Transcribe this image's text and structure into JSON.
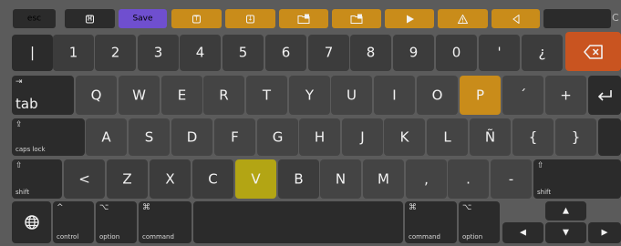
{
  "colors": {
    "keyboard_bg": "#5b5b5b",
    "key_dark": "#2b2b2b",
    "key_mid": "#3c3c3c",
    "toolbar_accent": "#c98c1a",
    "save_button": "#6f4fcf",
    "delete_key": "#c95420",
    "highlight_p": "#c98c1a",
    "highlight_v": "#b3a514"
  },
  "toolbar": {
    "esc_label": "esc",
    "save_label": "Save",
    "icons": [
      "calculator-icon",
      "text-tool-icon",
      "download-icon",
      "folder-add-icon",
      "folder-add-icon",
      "play-icon",
      "warning-icon",
      "volume-icon"
    ]
  },
  "rows": {
    "numbers": [
      "|",
      "1",
      "2",
      "3",
      "4",
      "5",
      "6",
      "7",
      "8",
      "9",
      "0",
      "'",
      "¿"
    ],
    "tab_label": "tab",
    "top": [
      "Q",
      "W",
      "E",
      "R",
      "T",
      "Y",
      "U",
      "I",
      "O",
      "P",
      "´",
      "+"
    ],
    "caps_label": "caps lock",
    "home": [
      "A",
      "S",
      "D",
      "F",
      "G",
      "H",
      "J",
      "K",
      "L",
      "Ñ",
      "{",
      "}"
    ],
    "shift_label": "shift",
    "bottom": [
      "<",
      "Z",
      "X",
      "C",
      "V",
      "B",
      "N",
      "M",
      ",",
      ".",
      "-"
    ],
    "control_label": "control",
    "option_label": "option",
    "command_label": "command"
  },
  "arrows": {
    "up": "▲",
    "left": "◀",
    "down": "▼",
    "right": "▶"
  }
}
